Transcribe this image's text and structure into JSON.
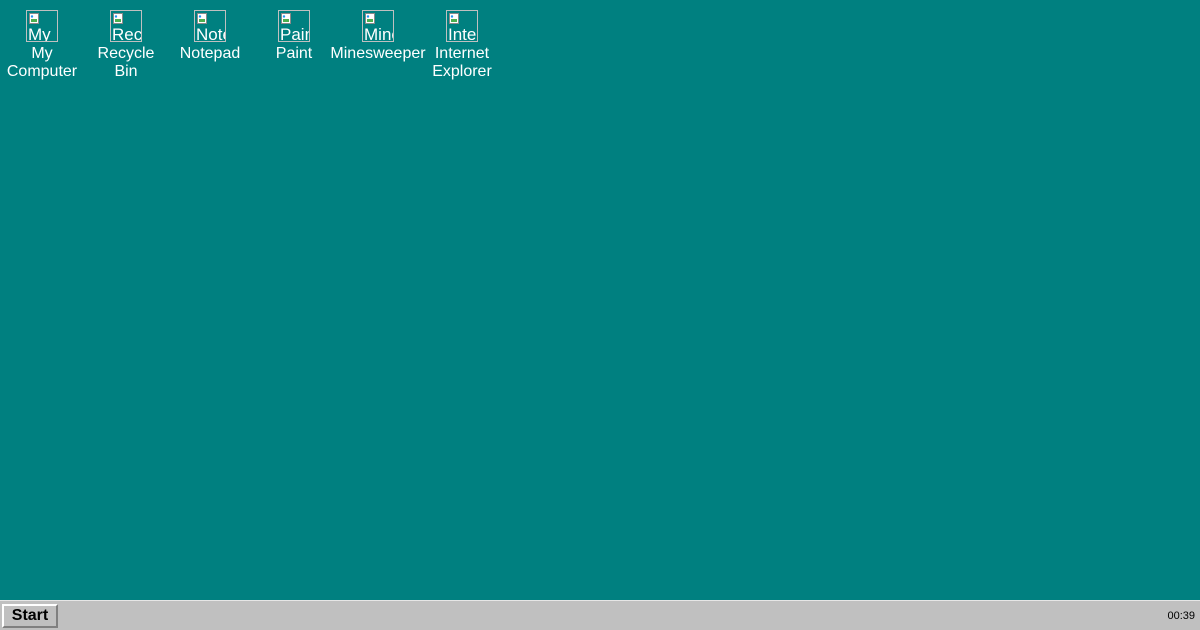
{
  "desktop": {
    "background_color": "#008080",
    "icons": [
      {
        "icon_name": "my-computer-icon",
        "alt": "My",
        "label": "My Computer"
      },
      {
        "icon_name": "recycle-bin-icon",
        "alt": "Rec",
        "label": "Recycle Bin"
      },
      {
        "icon_name": "notepad-icon",
        "alt": "Note",
        "label": "Notepad"
      },
      {
        "icon_name": "paint-icon",
        "alt": "Pain",
        "label": "Paint"
      },
      {
        "icon_name": "minesweeper-icon",
        "alt": "Mine",
        "label": "Minesweeper"
      },
      {
        "icon_name": "internet-explorer-icon",
        "alt": "Inter",
        "label": "Internet Explorer"
      }
    ]
  },
  "taskbar": {
    "start_label": "Start",
    "clock": "00:39",
    "background_color": "#c0c0c0"
  }
}
